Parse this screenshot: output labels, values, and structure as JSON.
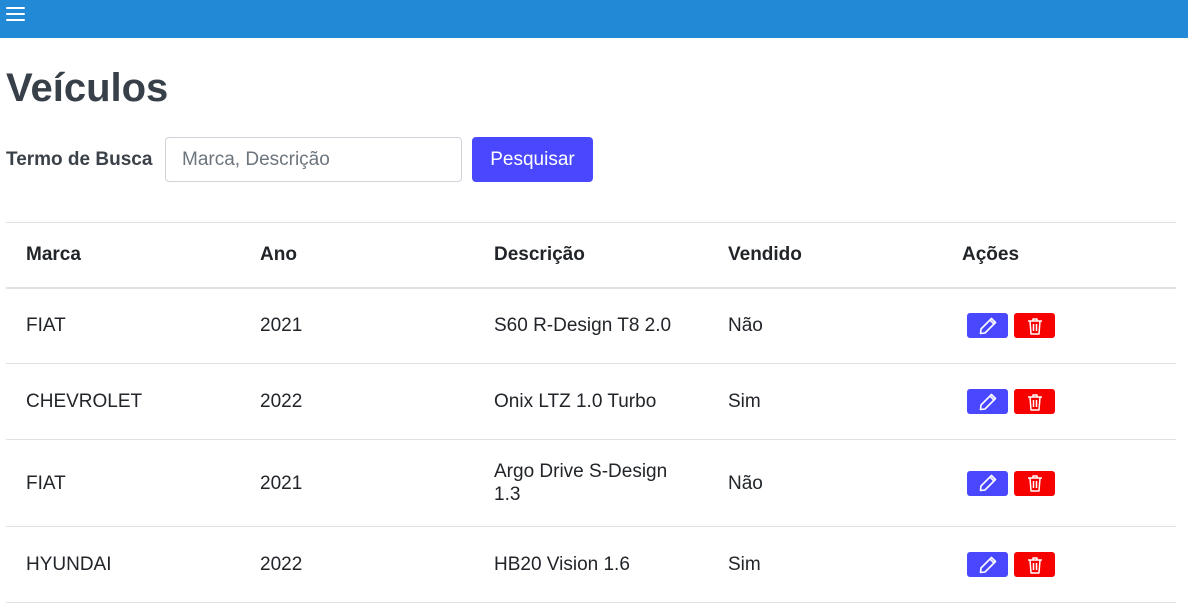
{
  "header": {
    "menu_icon": "hamburger-menu-icon",
    "bar_color": "#2289d6"
  },
  "page": {
    "title": "Veículos"
  },
  "search": {
    "label": "Termo de Busca",
    "placeholder": "Marca, Descrição",
    "value": "",
    "button_label": "Pesquisar",
    "button_color": "#4a48ff"
  },
  "table": {
    "columns": [
      "Marca",
      "Ano",
      "Descrição",
      "Vendido",
      "Ações"
    ],
    "rows": [
      {
        "marca": "FIAT",
        "ano": "2021",
        "descricao": "S60 R-Design T8 2.0",
        "vendido": "Não"
      },
      {
        "marca": "CHEVROLET",
        "ano": "2022",
        "descricao": "Onix LTZ 1.0 Turbo",
        "vendido": "Sim"
      },
      {
        "marca": "FIAT",
        "ano": "2021",
        "descricao": "Argo Drive S-Design 1.3",
        "vendido": "Não"
      },
      {
        "marca": "HYUNDAI",
        "ano": "2022",
        "descricao": "HB20 Vision 1.6",
        "vendido": "Sim"
      }
    ],
    "actions": {
      "edit_icon": "pencil-icon",
      "delete_icon": "trash-icon",
      "edit_color": "#4a48ff",
      "delete_color": "#f70000"
    }
  }
}
